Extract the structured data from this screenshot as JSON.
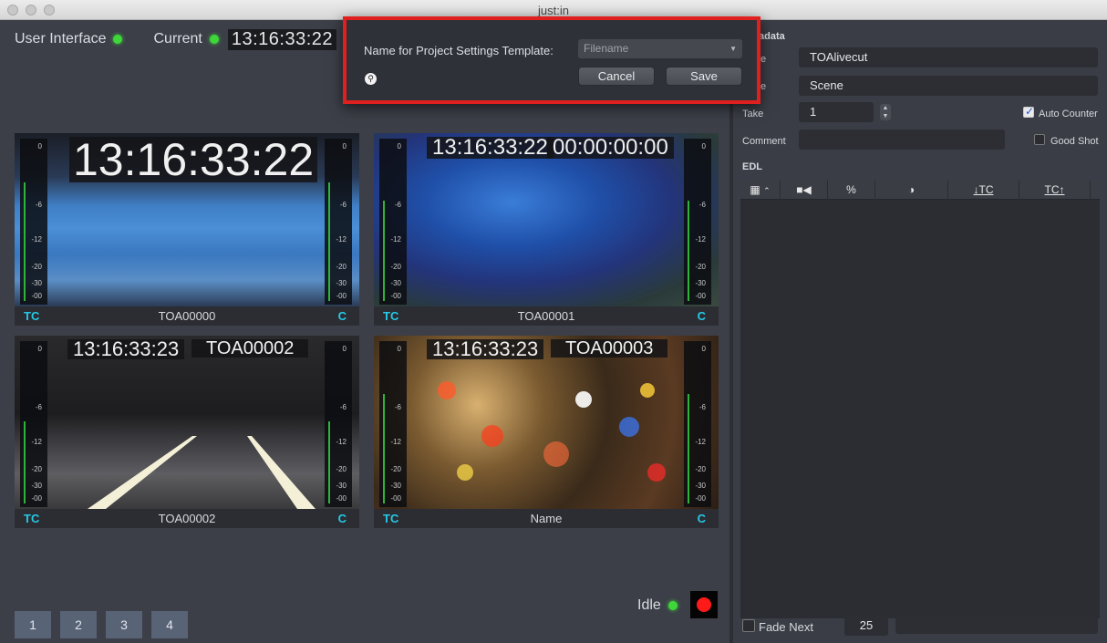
{
  "window": {
    "title": "just:in"
  },
  "status": {
    "ui_label": "User Interface",
    "current_label": "Current",
    "current_tc": "13:16:33:22"
  },
  "tiles": [
    {
      "tc": "13:16:33:22",
      "label": "",
      "name": "TOA00000"
    },
    {
      "tc": "13:16:33:22",
      "label": "00:00:00:00",
      "name": "TOA00001"
    },
    {
      "tc": "13:16:33:23",
      "label": "TOA00002",
      "name": "TOA00002"
    },
    {
      "tc": "13:16:33:23",
      "label": "TOA00003",
      "name": "Name"
    }
  ],
  "tile_footer": {
    "tc_label": "TC",
    "c_label": "C"
  },
  "meter_scale": [
    "0",
    "-6",
    "-12",
    "-20",
    "-30",
    "-00"
  ],
  "pages": [
    "1",
    "2",
    "3",
    "4"
  ],
  "idle_label": "Idle",
  "sidebar": {
    "section_metadata": "adata",
    "row1_label": "e",
    "row1_value": "TOAlivecut",
    "row2_label": "e",
    "row2_value": "Scene",
    "take_label": "Take",
    "take_value": "1",
    "auto_counter_label": "Auto Counter",
    "comment_label": "Comment",
    "good_shot_label": "Good Shot",
    "edl_label": "EDL",
    "edl_columns": [
      "%",
      "↓TC",
      "TC↑"
    ],
    "fade_next_label": "Fade Next",
    "fade_value": "25"
  },
  "dialog": {
    "prompt": "Name for Project Settings Template:",
    "select_value": "Filename",
    "cancel": "Cancel",
    "save": "Save"
  },
  "colors": {
    "accent_cyan": "#26c9e6",
    "status_green": "#3fd63a",
    "record_red": "#ff1a1a",
    "dialog_highlight": "#e0201e"
  }
}
